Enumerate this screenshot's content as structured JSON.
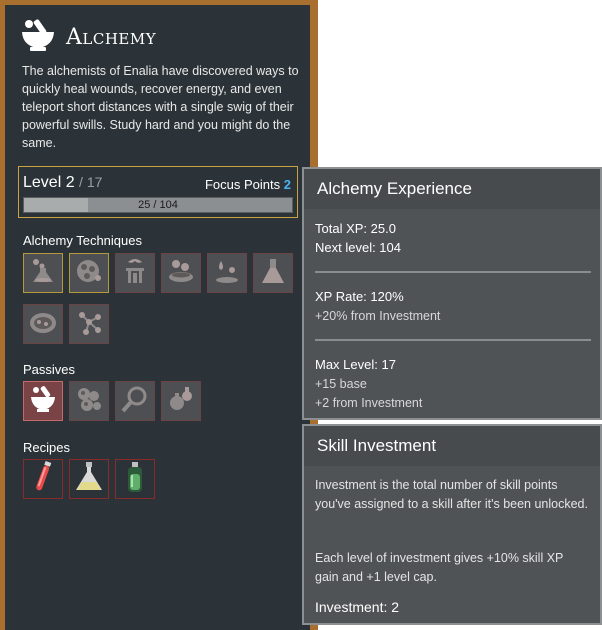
{
  "skill": {
    "title": "Alchemy",
    "description": "The alchemists of Enalia have discovered ways to quickly heal wounds, recover energy, and even teleport short distances with a single swig of their powerful swills. Study hard and you might do the same.",
    "level_label": "Level 2",
    "level_max": "/ 17",
    "focus_label": "Focus Points",
    "focus_value": "2",
    "xp_text": "25 / 104",
    "xp_fraction": 0.24
  },
  "sections": {
    "techniques": "Alchemy Techniques",
    "passives": "Passives",
    "recipes": "Recipes"
  },
  "techniques": [
    {
      "icon": "flask-bubbles-icon",
      "unlocked": true
    },
    {
      "icon": "spore-cluster-icon",
      "unlocked": true
    },
    {
      "icon": "flame-cauldron-icon",
      "unlocked": false
    },
    {
      "icon": "bubbling-dish-icon",
      "unlocked": false
    },
    {
      "icon": "drip-puddle-icon",
      "unlocked": false
    },
    {
      "icon": "erlenmeyer-flask-icon",
      "unlocked": false
    },
    {
      "icon": "slime-blob-icon",
      "unlocked": false
    },
    {
      "icon": "molecule-icon",
      "unlocked": false
    }
  ],
  "passives": [
    {
      "icon": "mortar-pestle-icon",
      "active": true
    },
    {
      "icon": "bubbles-icon",
      "active": false
    },
    {
      "icon": "magnifier-icon",
      "active": false
    },
    {
      "icon": "potion-pair-icon",
      "active": false
    }
  ],
  "recipes": [
    {
      "icon": "red-vial-icon"
    },
    {
      "icon": "yellow-potion-icon"
    },
    {
      "icon": "green-bottle-icon"
    }
  ],
  "tooltip_xp": {
    "title": "Alchemy Experience",
    "total_xp": "Total XP: 25.0",
    "next_level": "Next level: 104",
    "xp_rate": "XP Rate: 120%",
    "xp_rate_detail": "+20% from Investment",
    "max_level": "Max Level: 17",
    "max_level_base": "+15 base",
    "max_level_investment": "+2 from Investment"
  },
  "tooltip_investment": {
    "title": "Skill Investment",
    "para1": "Investment is the total number of skill points you've assigned to a skill after it's been unlocked.",
    "para2": "Each level of investment gives +10% skill XP gain and +1 level cap.",
    "investment": "Investment: 2"
  },
  "colors": {
    "frame": "#a86f2e",
    "panel": "#2c3338",
    "focus_accent": "#4ab4f0",
    "level_border": "#c9a241"
  }
}
